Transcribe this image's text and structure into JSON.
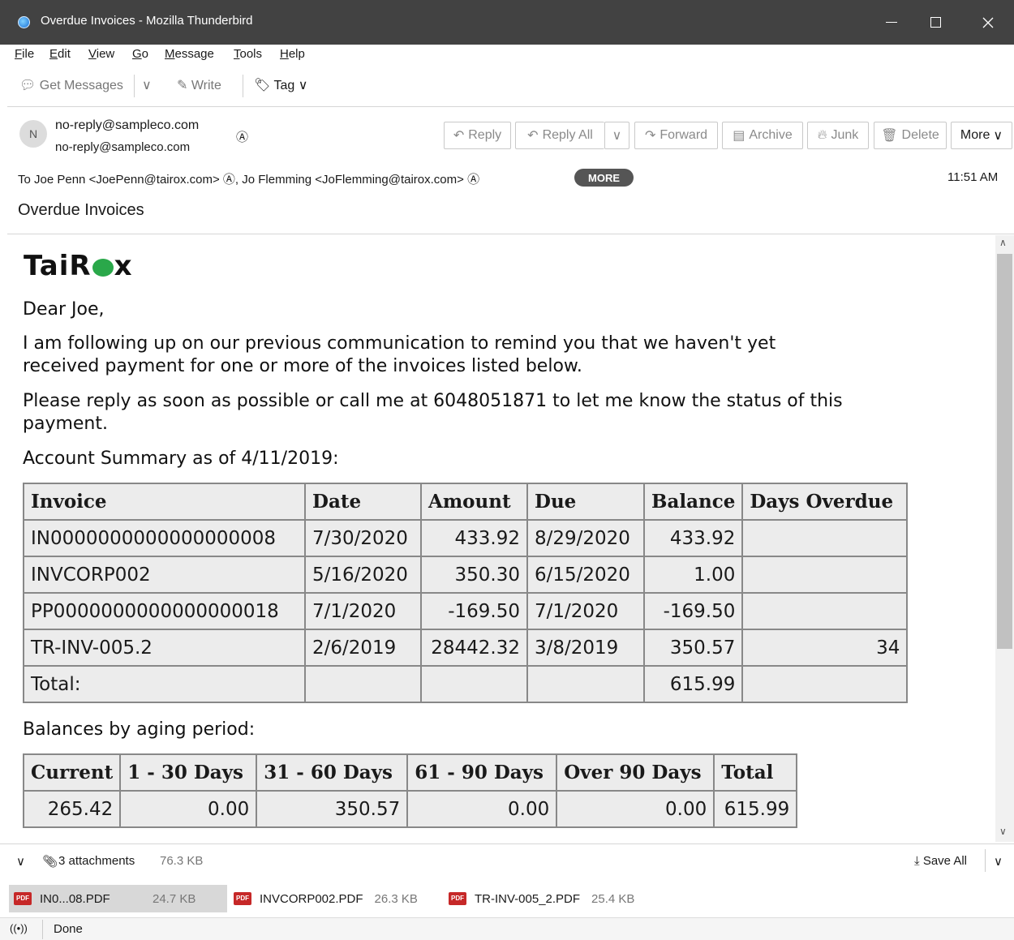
{
  "window": {
    "title": "Overdue Invoices - Mozilla Thunderbird"
  },
  "menu": [
    "File",
    "Edit",
    "View",
    "Go",
    "Message",
    "Tools",
    "Help"
  ],
  "toolbar": {
    "get_messages": "Get Messages",
    "write": "Write",
    "tag": "Tag"
  },
  "header": {
    "avatar_letter": "N",
    "from_name": "no-reply@sampleco.com",
    "from_email": "no-reply@sampleco.com",
    "buttons": {
      "reply": "Reply",
      "reply_all": "Reply All",
      "forward": "Forward",
      "archive": "Archive",
      "junk": "Junk",
      "delete": "Delete",
      "more": "More"
    },
    "to_label": "To",
    "recipient1": "Joe Penn <JoePenn@tairox.com>",
    "recipient2": "Jo Flemming <JoFlemming@tairox.com>",
    "more_pill": "MORE",
    "time": "11:51 AM",
    "subject": "Overdue Invoices"
  },
  "body": {
    "logo_left": "TaiR",
    "logo_right": "x",
    "greeting": "Dear Joe,",
    "para1": "I am following up on our previous communication to remind you that we haven't yet received payment for one or more of the invoices listed below.",
    "para2": "Please reply as soon as possible or call me at 6048051871 to let me know the status of this payment.",
    "summary_label": "Account Summary as of 4/11/2019:",
    "invoice_table": {
      "headers": [
        "Invoice",
        "Date",
        "Amount",
        "Due",
        "Balance",
        "Days Overdue"
      ],
      "rows": [
        [
          "IN0000000000000000008",
          "7/30/2020",
          "433.92",
          "8/29/2020",
          "433.92",
          ""
        ],
        [
          "INVCORP002",
          "5/16/2020",
          "350.30",
          "6/15/2020",
          "1.00",
          ""
        ],
        [
          "PP0000000000000000018",
          "7/1/2020",
          "-169.50",
          "7/1/2020",
          "-169.50",
          ""
        ],
        [
          "TR-INV-005.2",
          "2/6/2019",
          "28442.32",
          "3/8/2019",
          "350.57",
          "34"
        ],
        [
          "Total:",
          "",
          "",
          "",
          "615.99",
          ""
        ]
      ]
    },
    "aging_label": "Balances by aging period:",
    "aging_table": {
      "headers": [
        "Current",
        "1 - 30 Days",
        "31 - 60 Days",
        "61 - 90 Days",
        "Over 90 Days",
        "Total"
      ],
      "values": [
        "265.42",
        "0.00",
        "350.57",
        "0.00",
        "0.00",
        "615.99"
      ]
    }
  },
  "attachments": {
    "summary": "3 attachments",
    "total_size": "76.3 KB",
    "save_all": "Save All",
    "files": [
      {
        "name": "IN0...08.PDF",
        "size": "24.7 KB"
      },
      {
        "name": "INVCORP002.PDF",
        "size": "26.3 KB"
      },
      {
        "name": "TR-INV-005_2.PDF",
        "size": "25.4 KB"
      }
    ]
  },
  "status": {
    "text": "Done"
  }
}
